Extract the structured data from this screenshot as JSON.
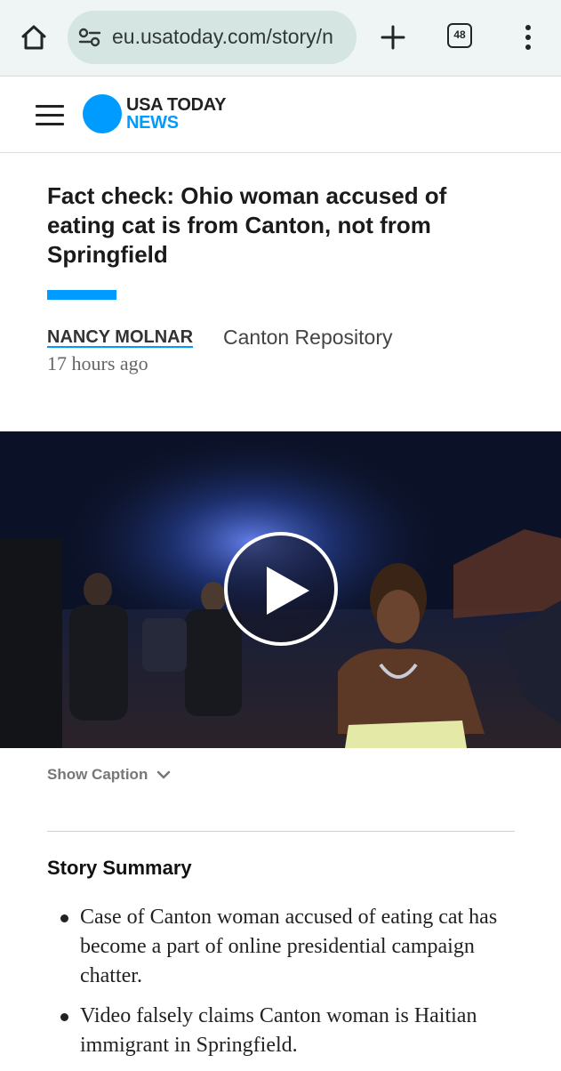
{
  "browser": {
    "url": "eu.usatoday.com/story/n",
    "tab_count": "48"
  },
  "site": {
    "logo_line1": "USA TODAY",
    "logo_line2": "NEWS",
    "brand_color": "#009bff"
  },
  "article": {
    "headline": "Fact check: Ohio woman accused of eating cat is from Canton, not from Springfield",
    "author": "NANCY MOLNAR",
    "source": "Canton Repository",
    "timestamp": "17 hours ago"
  },
  "video": {
    "show_caption_label": "Show Caption"
  },
  "summary": {
    "title": "Story Summary",
    "items": [
      "Case of Canton woman accused of eating cat has become a part of online presidential campaign chatter.",
      "Video falsely claims Canton woman is Haitian immigrant in Springfield."
    ]
  },
  "icons": {
    "home": "home-icon",
    "site_settings": "site-settings-icon",
    "new_tab": "plus-icon",
    "tabs": "tab-switcher-icon",
    "menu": "more-vert-icon",
    "nav": "hamburger-menu-icon",
    "play": "play-icon",
    "caption_toggle": "chevron-down-icon"
  }
}
